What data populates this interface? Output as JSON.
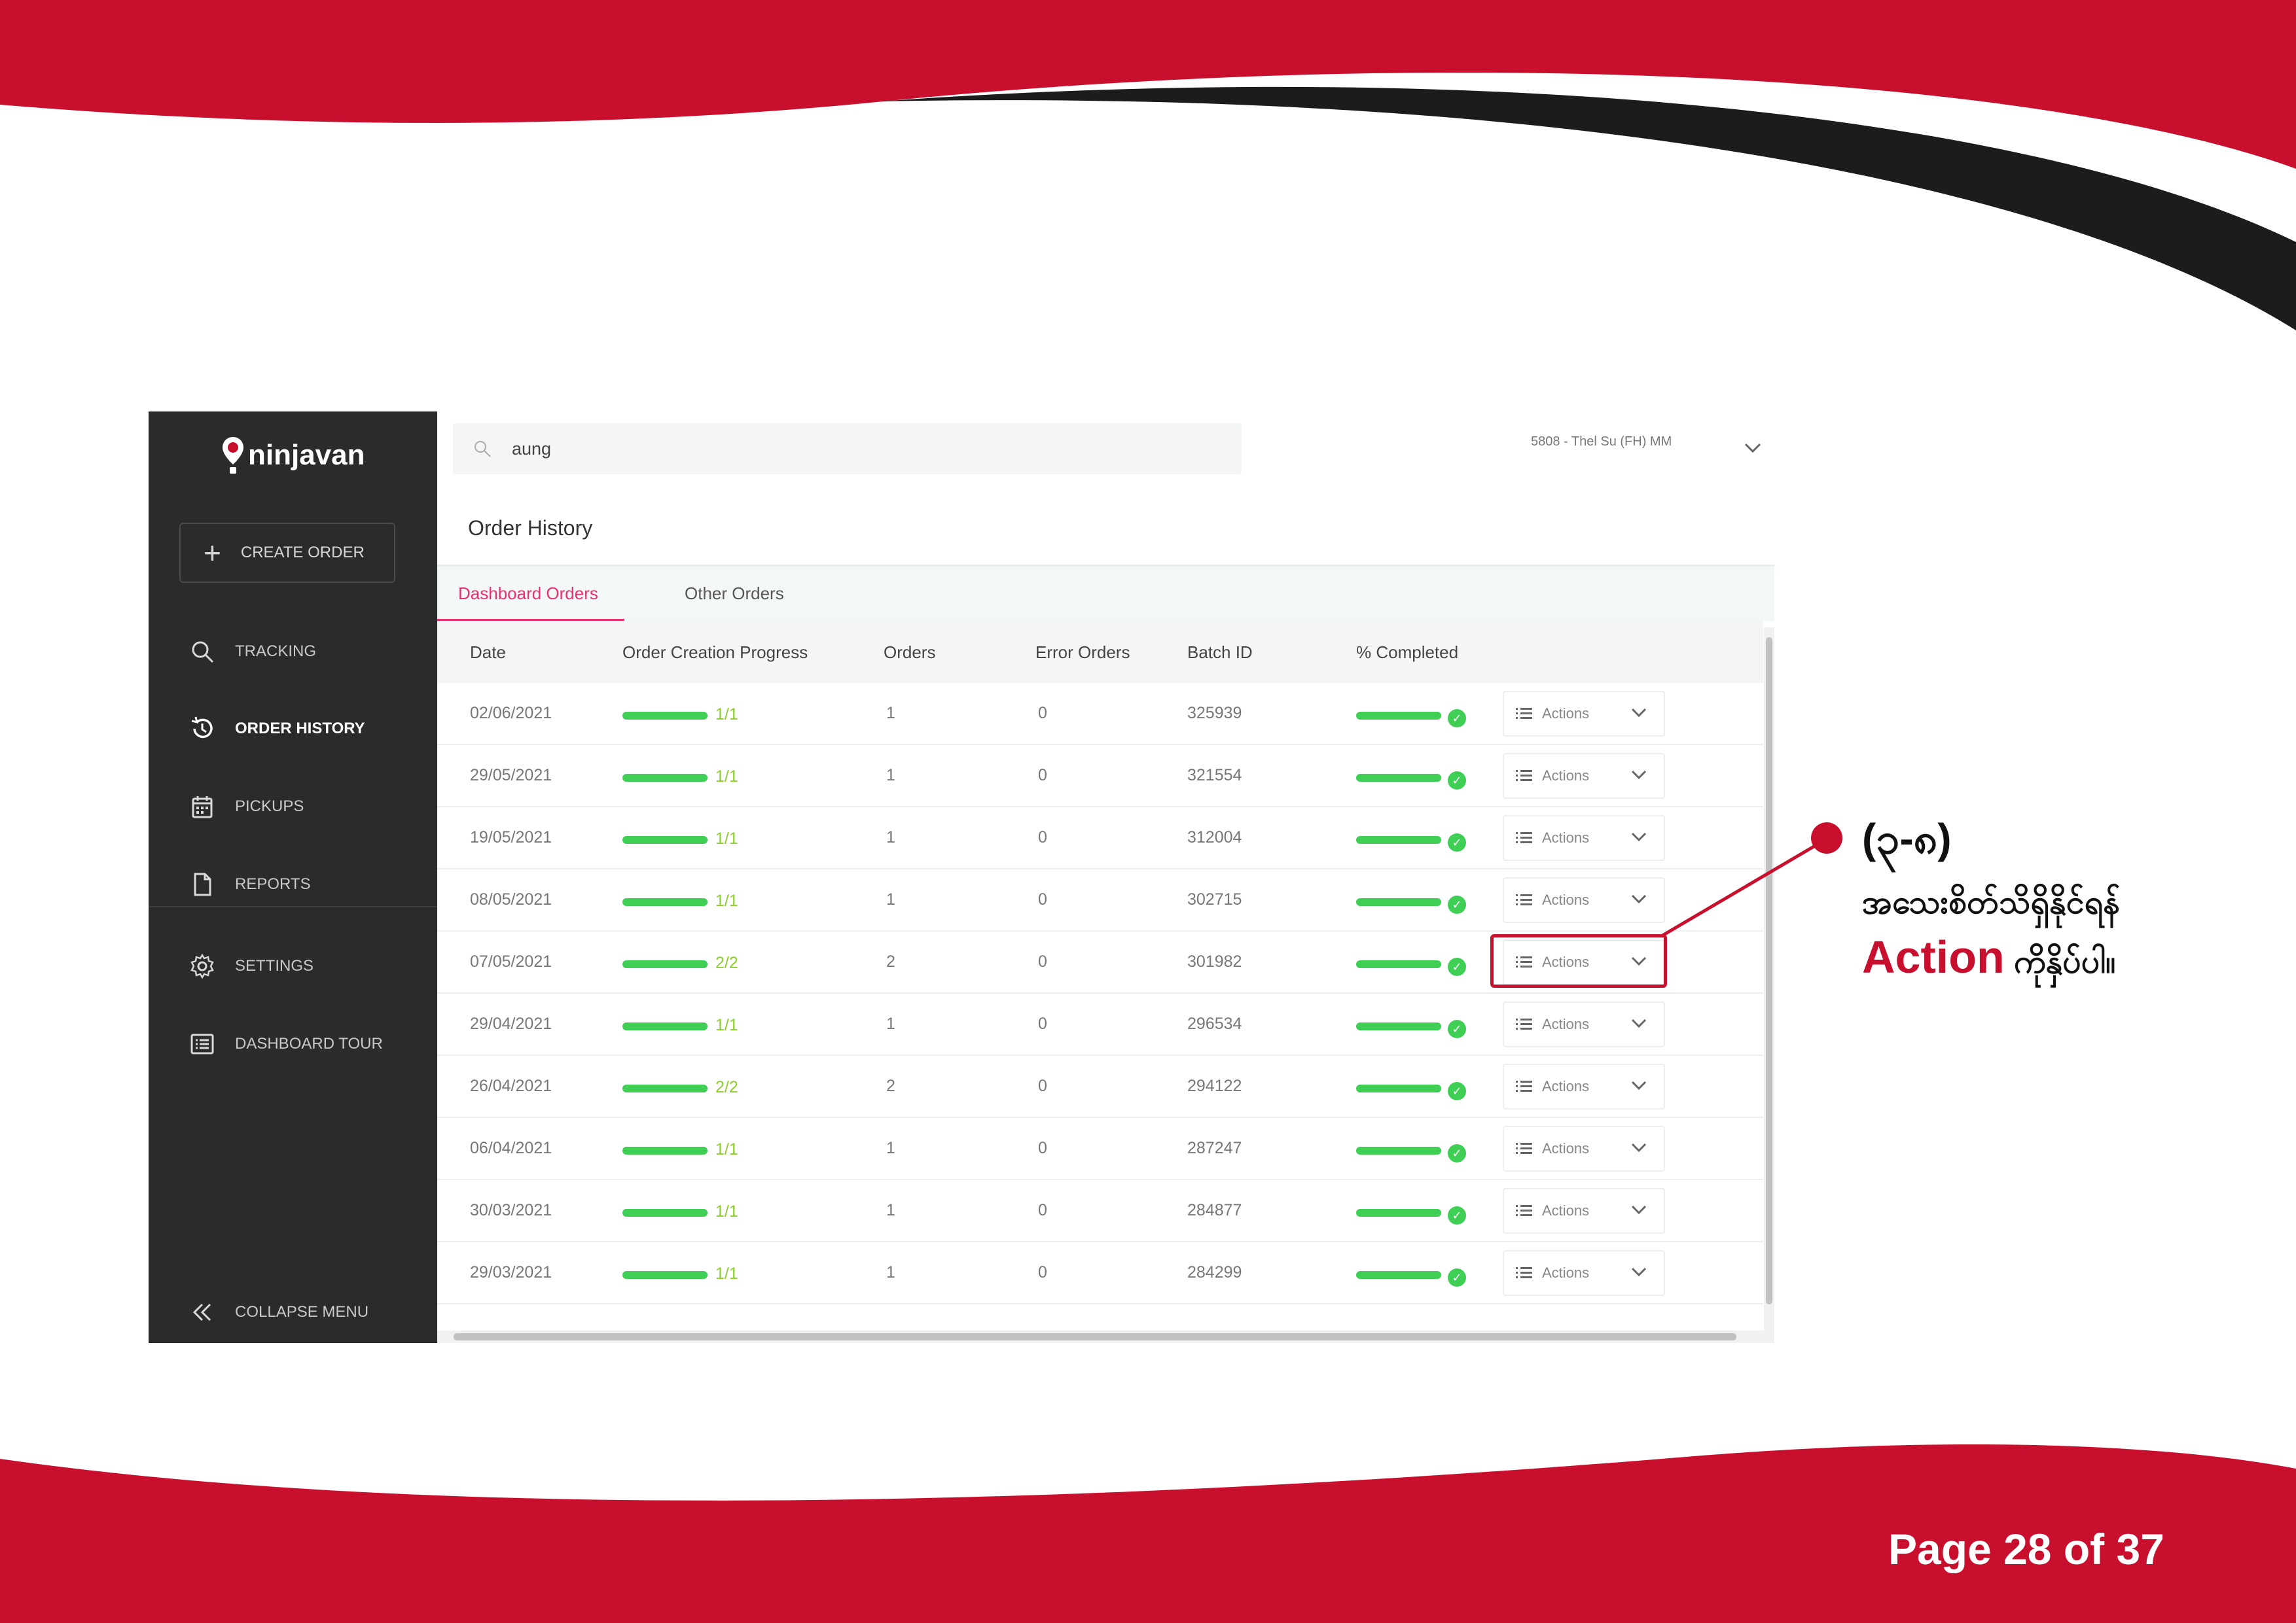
{
  "colors": {
    "brand_red": "#c8102e",
    "dark_swoosh": "#1c1c1c",
    "sidebar_bg": "#2a2b2d",
    "active_tab": "#e8316f",
    "progress_green": "#3fcf55",
    "progress_text_green": "#8ccf2d"
  },
  "app": {
    "logo_text": "ninjavan",
    "create_order_label": "CREATE ORDER",
    "nav": [
      {
        "label": "TRACKING",
        "icon": "search-icon",
        "active": false
      },
      {
        "label": "ORDER HISTORY",
        "icon": "history-icon",
        "active": true
      },
      {
        "label": "PICKUPS",
        "icon": "calendar-icon",
        "active": false
      },
      {
        "label": "REPORTS",
        "icon": "document-icon",
        "active": false
      },
      {
        "label": "SETTINGS",
        "icon": "gear-icon",
        "active": false
      },
      {
        "label": "DASHBOARD TOUR",
        "icon": "list-icon",
        "active": false
      }
    ],
    "collapse_label": "COLLAPSE MENU",
    "search_value": "aung",
    "user_label": "5808 - Thel Su (FH) MM",
    "page_title": "Order History",
    "tabs": [
      "Dashboard Orders",
      "Other Orders"
    ],
    "columns": [
      "Date",
      "Order Creation Progress",
      "Orders",
      "Error Orders",
      "Batch ID",
      "% Completed"
    ],
    "actions_label": "Actions",
    "rows": [
      {
        "date": "02/06/2021",
        "progress": "1/1",
        "completed_fraction": 1.0,
        "orders": "1",
        "errors": "0",
        "batch": "325939"
      },
      {
        "date": "29/05/2021",
        "progress": "1/1",
        "completed_fraction": 1.0,
        "orders": "1",
        "errors": "0",
        "batch": "321554"
      },
      {
        "date": "19/05/2021",
        "progress": "1/1",
        "completed_fraction": 1.0,
        "orders": "1",
        "errors": "0",
        "batch": "312004"
      },
      {
        "date": "08/05/2021",
        "progress": "1/1",
        "completed_fraction": 1.0,
        "orders": "1",
        "errors": "0",
        "batch": "302715"
      },
      {
        "date": "07/05/2021",
        "progress": "2/2",
        "completed_fraction": 1.0,
        "orders": "2",
        "errors": "0",
        "batch": "301982"
      },
      {
        "date": "29/04/2021",
        "progress": "1/1",
        "completed_fraction": 1.0,
        "orders": "1",
        "errors": "0",
        "batch": "296534"
      },
      {
        "date": "26/04/2021",
        "progress": "2/2",
        "completed_fraction": 1.0,
        "orders": "2",
        "errors": "0",
        "batch": "294122"
      },
      {
        "date": "06/04/2021",
        "progress": "1/1",
        "completed_fraction": 1.0,
        "orders": "1",
        "errors": "0",
        "batch": "287247"
      },
      {
        "date": "30/03/2021",
        "progress": "1/1",
        "completed_fraction": 1.0,
        "orders": "1",
        "errors": "0",
        "batch": "284877"
      },
      {
        "date": "29/03/2021",
        "progress": "1/1",
        "completed_fraction": 1.0,
        "orders": "1",
        "errors": "0",
        "batch": "284299"
      }
    ]
  },
  "callout": {
    "title": "(၃-၈)",
    "line1": "အသေးစိတ်သိရှိနိုင်ရန်",
    "line2_accent": "Action",
    "line2_rest": " ကိုနှိပ်ပါ။"
  },
  "footer": {
    "page_label": "Page 28 of 37"
  }
}
